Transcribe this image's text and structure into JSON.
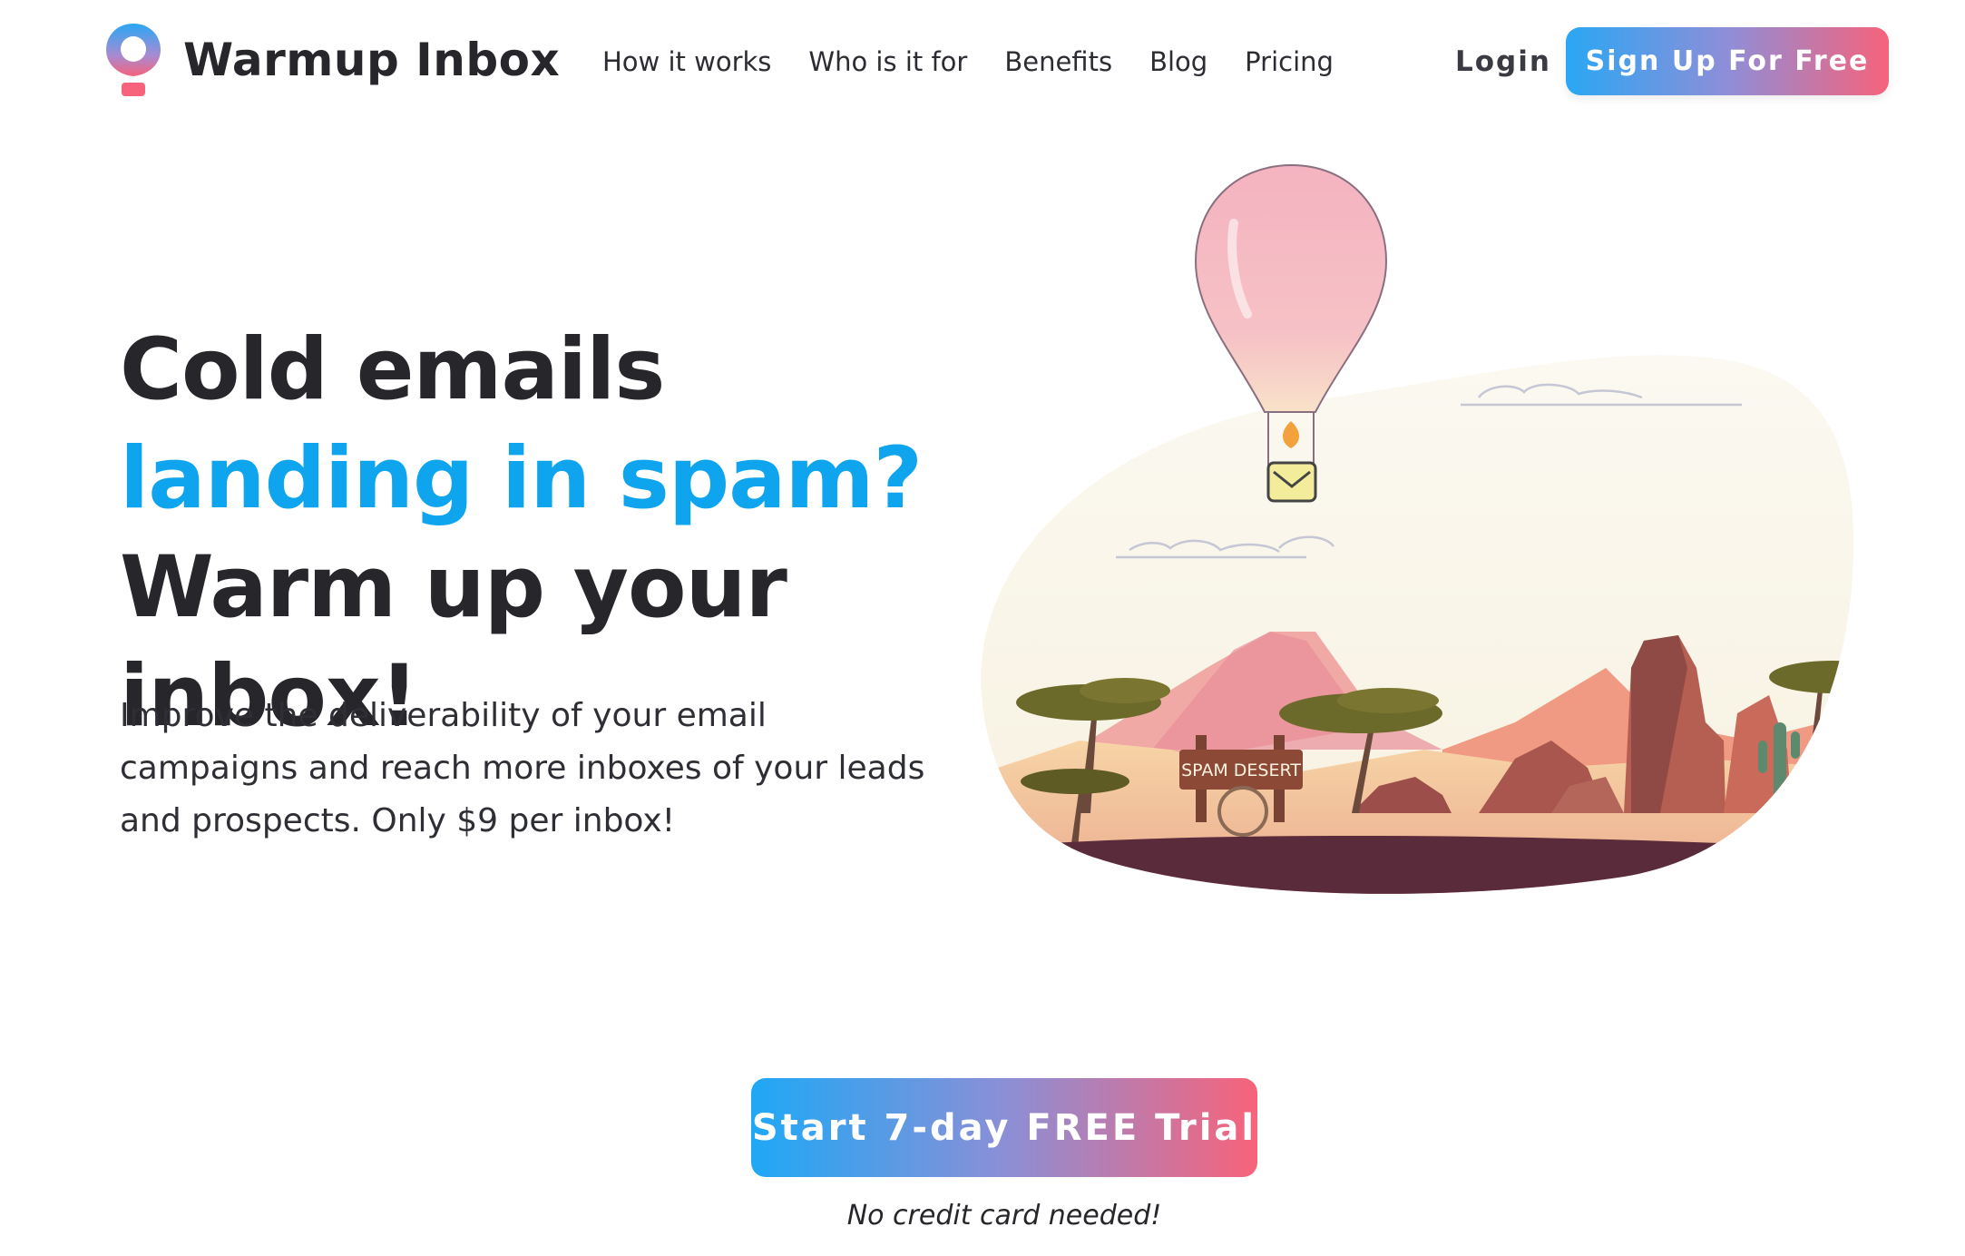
{
  "brand": {
    "name": "Warmup Inbox",
    "colors": {
      "accent_blue": "#0ea5ee",
      "gradient_start": "#2aa7f4",
      "gradient_end": "#f6637b",
      "text": "#26262b"
    }
  },
  "nav": {
    "items": [
      {
        "label": "How it works"
      },
      {
        "label": "Who is it for"
      },
      {
        "label": "Benefits"
      },
      {
        "label": "Blog"
      },
      {
        "label": "Pricing"
      }
    ],
    "login_label": "Login",
    "signup_label": "Sign Up For Free"
  },
  "hero": {
    "headline_part1": "Cold emails ",
    "headline_highlight": "landing in spam?",
    "headline_part2": " Warm up your inbox!",
    "subtext": "Improve the deliverability of your email campaigns and reach more inboxes of your leads and prospects. Only $9 per inbox!",
    "illustration": {
      "icons": [
        "hot-air-balloon",
        "envelope",
        "flame",
        "clouds",
        "desert-trees",
        "rocks",
        "cactus"
      ],
      "sign_text": "SPAM DESERT"
    }
  },
  "cta": {
    "button_label": "Start 7-day FREE Trial",
    "note": "No credit card needed!"
  }
}
